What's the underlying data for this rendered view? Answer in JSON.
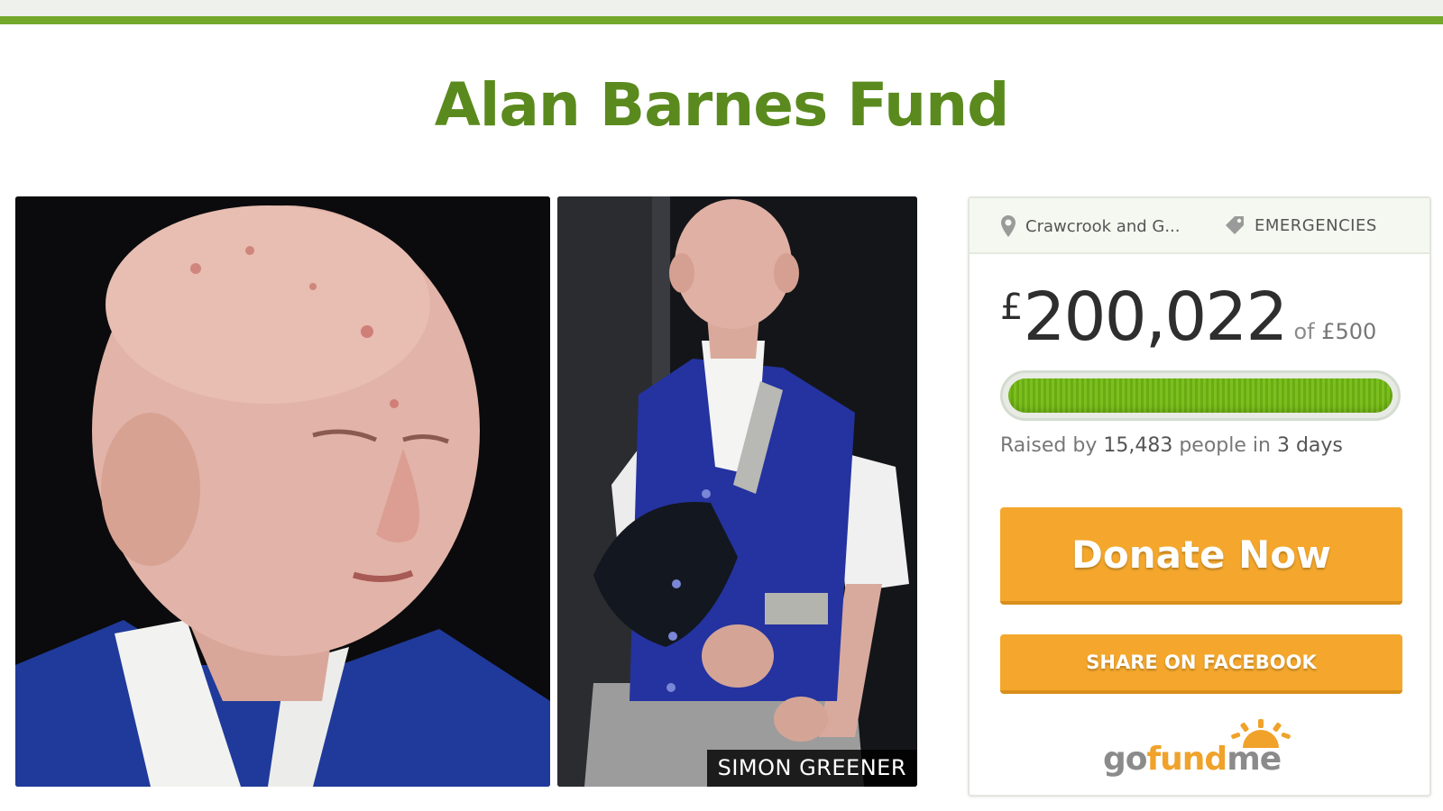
{
  "page": {
    "title": "Alan Barnes Fund"
  },
  "photos": {
    "credit": "SIMON GREENER"
  },
  "campaign": {
    "location": "Crawcrook and G...",
    "category": "EMERGENCIES",
    "currency_symbol": "£",
    "amount_raised": "200,022",
    "goal_prefix": "of",
    "goal": "£500",
    "progress_fraction": 1.0,
    "raised_by_prefix": "Raised by",
    "donor_count": "15,483",
    "people_in": "people in",
    "days": "3 days",
    "donate_label": "Donate Now",
    "share_label": "SHARE ON FACEBOOK"
  },
  "logo": {
    "go": "go",
    "fund": "fund",
    "me": "me"
  },
  "icons": {
    "location": "map-pin-icon",
    "category": "tag-icon"
  },
  "colors": {
    "brand_green": "#5a8a1e",
    "progress_green": "#7cbf1e",
    "button_orange": "#f4a72c"
  }
}
